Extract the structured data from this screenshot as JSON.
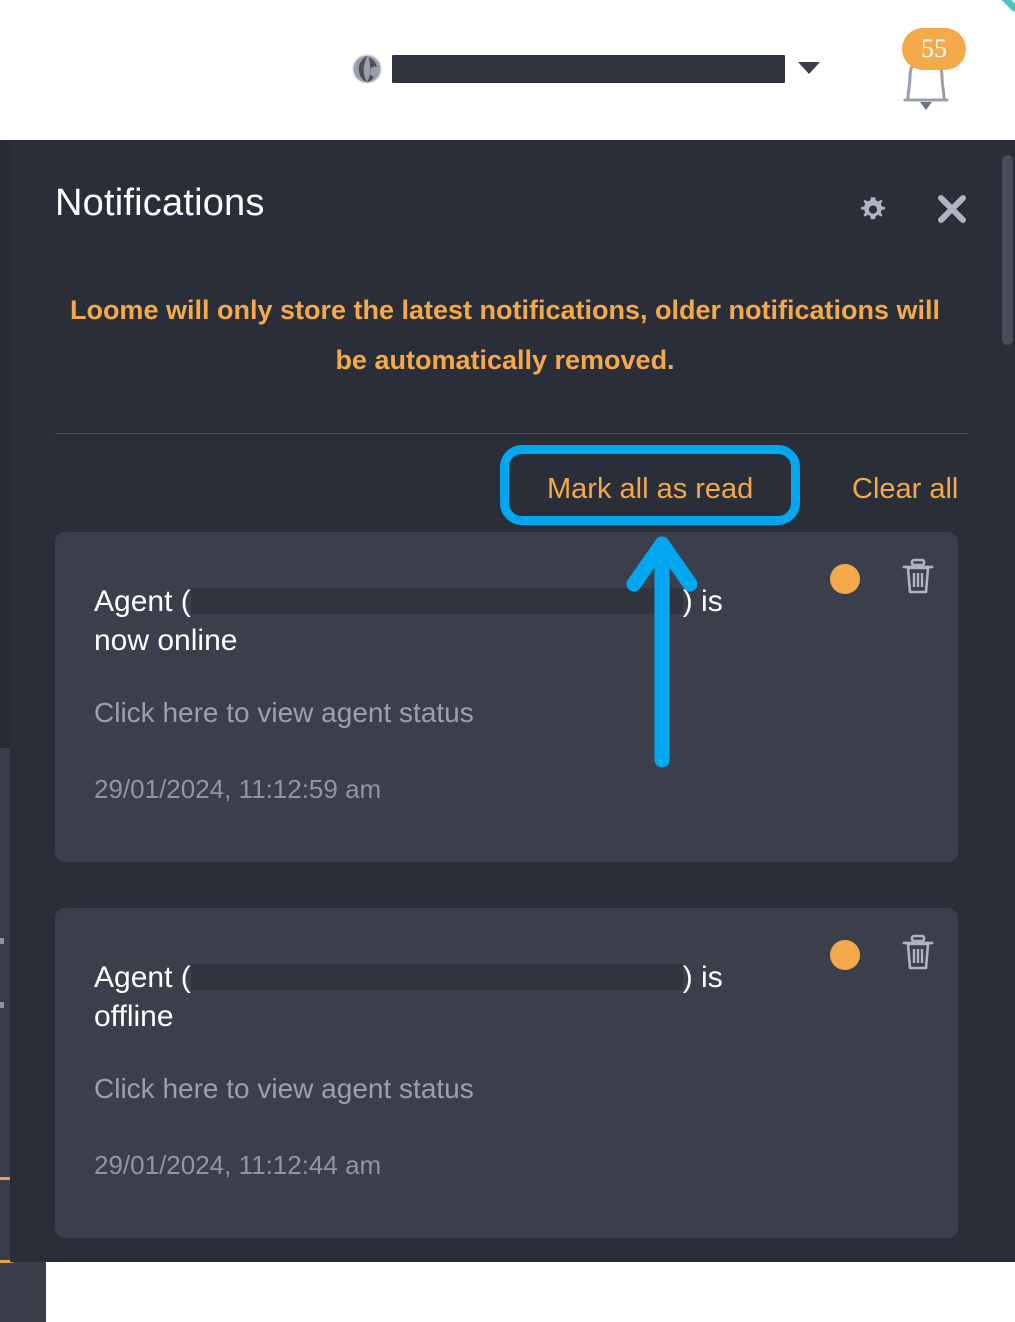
{
  "topbar": {
    "globe_icon": "globe-icon",
    "site_selector": {
      "value": "",
      "redacted": true,
      "caret_icon": "chevron-down-icon"
    },
    "notifications_bell": {
      "icon": "bell-icon",
      "badge_count": "55"
    }
  },
  "panel": {
    "title": "Notifications",
    "settings_icon": "gear-icon",
    "close_icon": "close-icon",
    "note": "Loome will only store the latest notifications, older notifications will be automatically removed.",
    "actions": {
      "mark_all_as_read": "Mark all as read",
      "clear_all": "Clear all"
    },
    "scrollbar": "vertical-scrollbar"
  },
  "annotations": {
    "highlight_target": "Mark all as read",
    "highlight_color": "#02a7f0",
    "arrow_color": "#02a7f0",
    "corner_accent_color": "#4bc3c3"
  },
  "colors": {
    "panel_bg": "#2a2e39",
    "card_bg": "#3a3f4b",
    "accent_orange": "#f4a94a",
    "muted_text": "#9aa0ad",
    "redaction": "#30343f"
  },
  "notifications": [
    {
      "title_prefix": "Agent (",
      "title_redacted": true,
      "title_suffix": ") is",
      "title_second_line": "now online",
      "subtitle": "Click here to view agent status",
      "timestamp": "29/01/2024, 11:12:59 am",
      "unread_dot": "unread-status-dot",
      "delete_icon": "trash-icon"
    },
    {
      "title_prefix": "Agent (",
      "title_redacted": true,
      "title_suffix": ") is",
      "title_second_line": "offline",
      "subtitle": "Click here to view agent status",
      "timestamp": "29/01/2024, 11:12:44 am",
      "unread_dot": "unread-status-dot",
      "delete_icon": "trash-icon"
    }
  ]
}
